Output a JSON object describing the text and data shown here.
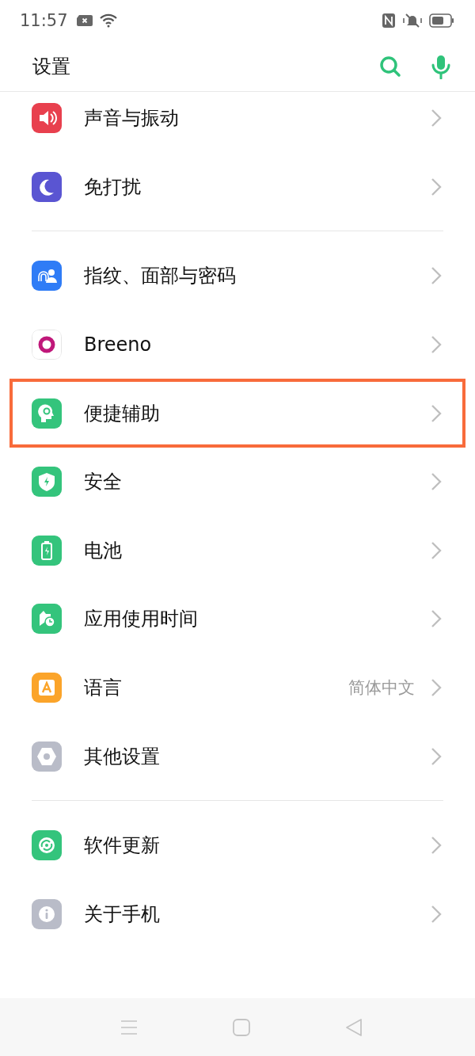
{
  "status_bar": {
    "time": "11:57"
  },
  "header": {
    "title": "设置"
  },
  "groups": [
    {
      "items": [
        {
          "label": "声音与振动",
          "color": "#e8404e",
          "highlighted": false
        },
        {
          "label": "免打扰",
          "color": "#5a55d2",
          "highlighted": false
        }
      ]
    },
    {
      "items": [
        {
          "label": "指纹、面部与密码",
          "color": "#2f7cf6",
          "highlighted": false
        },
        {
          "label": "Breeno",
          "color": "#ffffff",
          "highlighted": false
        },
        {
          "label": "便捷辅助",
          "color": "#34c47c",
          "highlighted": true
        },
        {
          "label": "安全",
          "color": "#34c47c",
          "highlighted": false
        },
        {
          "label": "电池",
          "color": "#34c47c",
          "highlighted": false
        },
        {
          "label": "应用使用时间",
          "color": "#34c47c",
          "highlighted": false
        },
        {
          "label": "语言",
          "value": "简体中文",
          "color": "#fba42a",
          "highlighted": false
        },
        {
          "label": "其他设置",
          "color": "#b9bcc8",
          "highlighted": false
        }
      ]
    },
    {
      "items": [
        {
          "label": "软件更新",
          "color": "#34c47c",
          "highlighted": false
        },
        {
          "label": "关于手机",
          "color": "#b9bcc8",
          "highlighted": false
        }
      ]
    }
  ]
}
